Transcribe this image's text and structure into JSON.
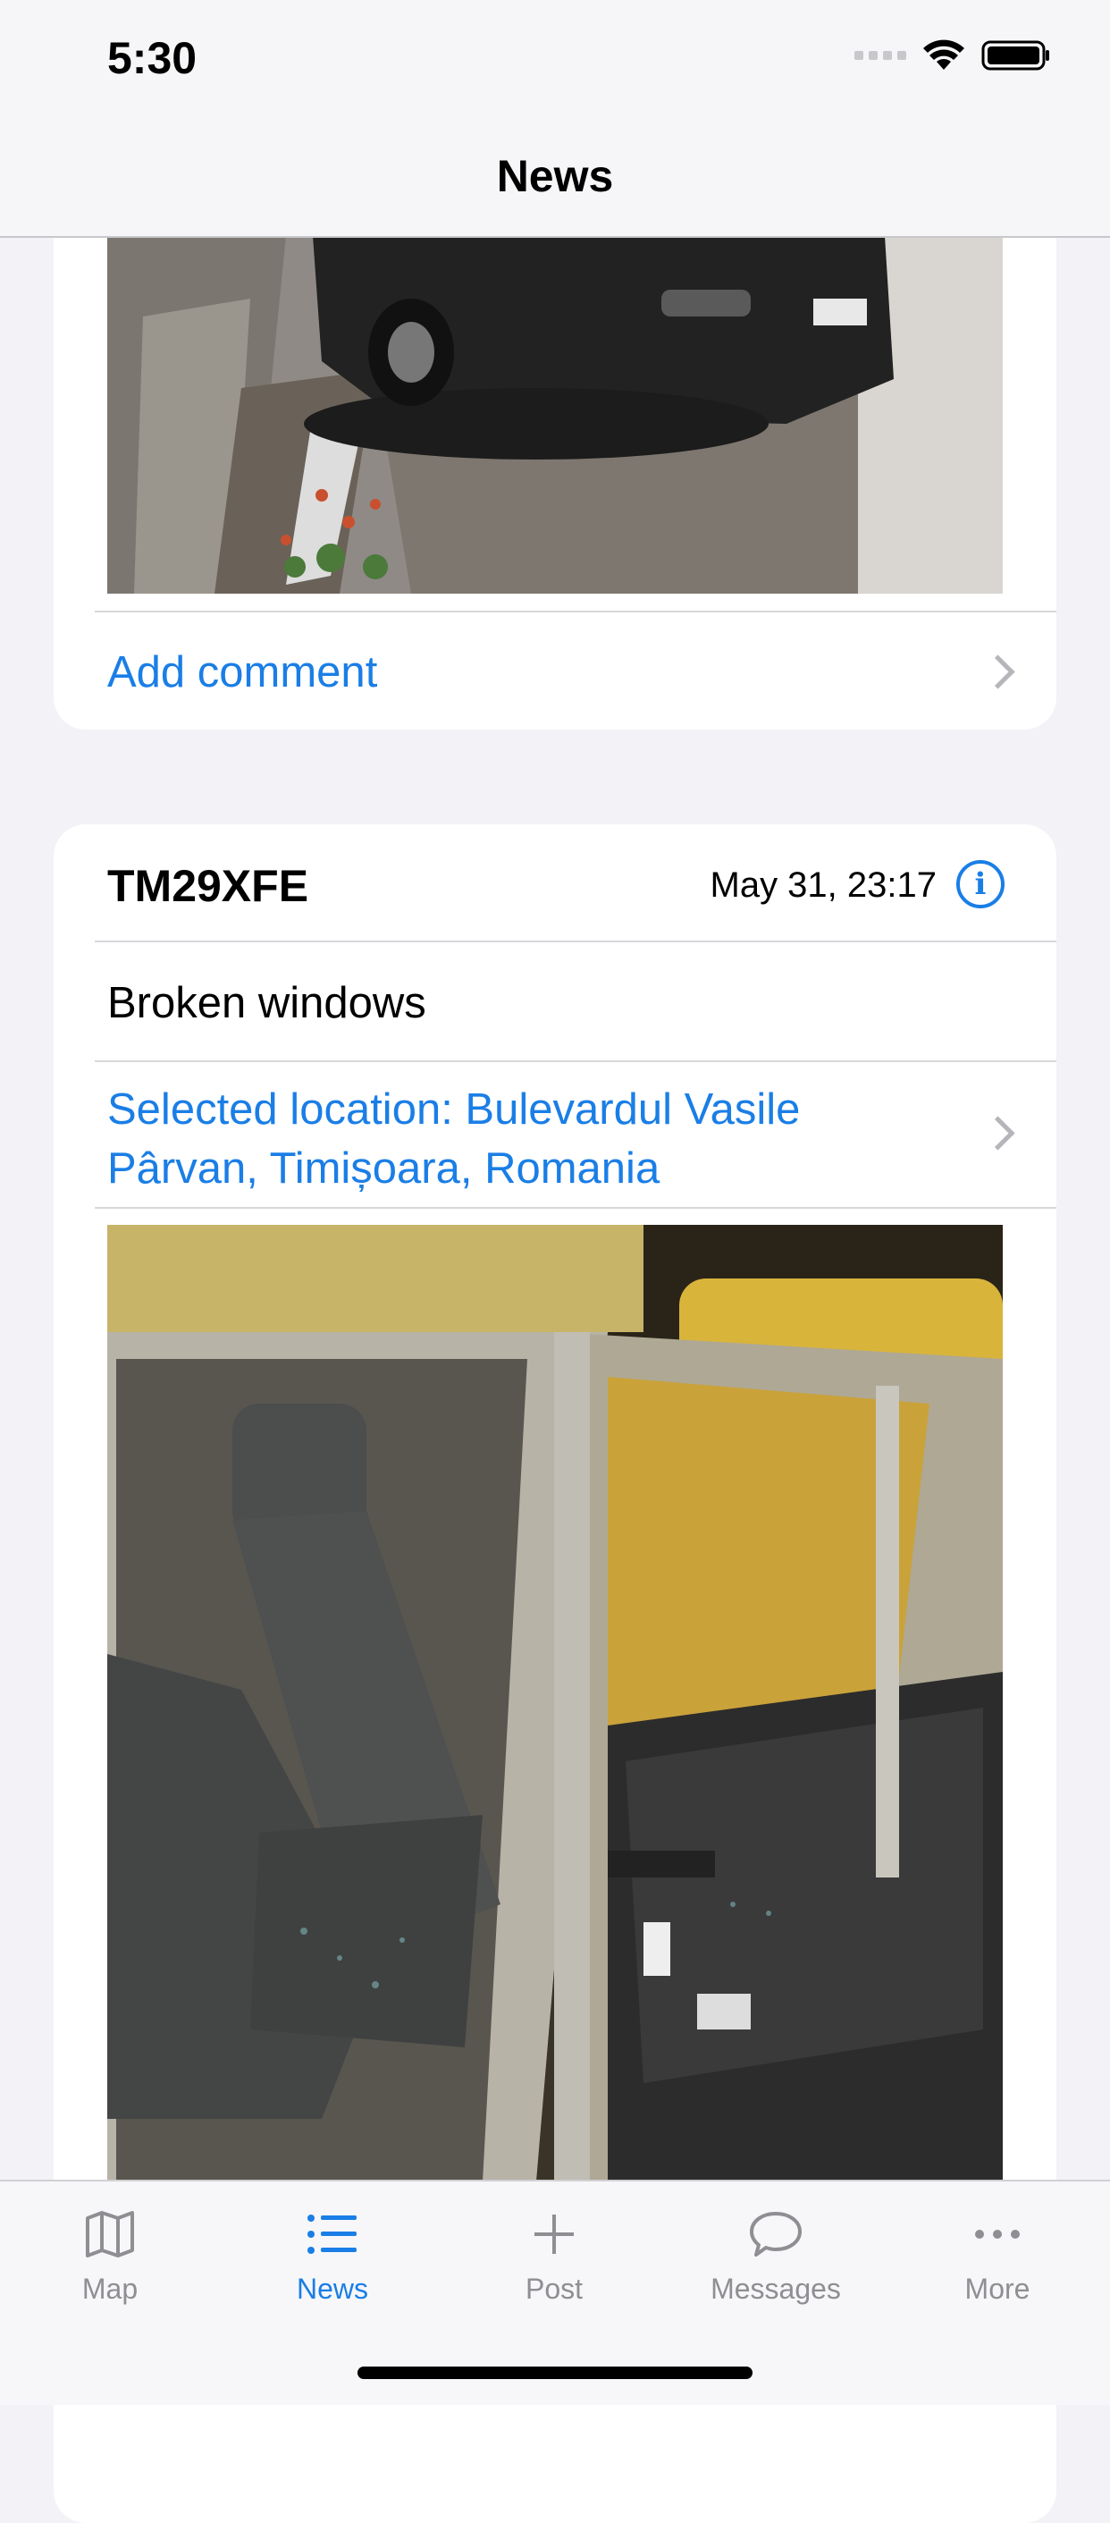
{
  "status_bar": {
    "time": "5:30"
  },
  "nav": {
    "title": "News"
  },
  "post1": {
    "add_comment": "Add comment"
  },
  "post2": {
    "plate": "TM29XFE",
    "date": "May 31, 23:17",
    "description": "Broken windows",
    "location": "Selected location: Bulevardul Vasile Pârvan, Timișoara, Romania"
  },
  "tabs": [
    {
      "label": "Map",
      "icon": "map-icon"
    },
    {
      "label": "News",
      "icon": "list-icon"
    },
    {
      "label": "Post",
      "icon": "plus-icon"
    },
    {
      "label": "Messages",
      "icon": "chat-bubble-icon"
    },
    {
      "label": "More",
      "icon": "ellipsis-icon"
    }
  ],
  "colors": {
    "accent": "#1a7ee6",
    "inactive_tab": "#8e8e93",
    "background": "#f2f2f7"
  }
}
